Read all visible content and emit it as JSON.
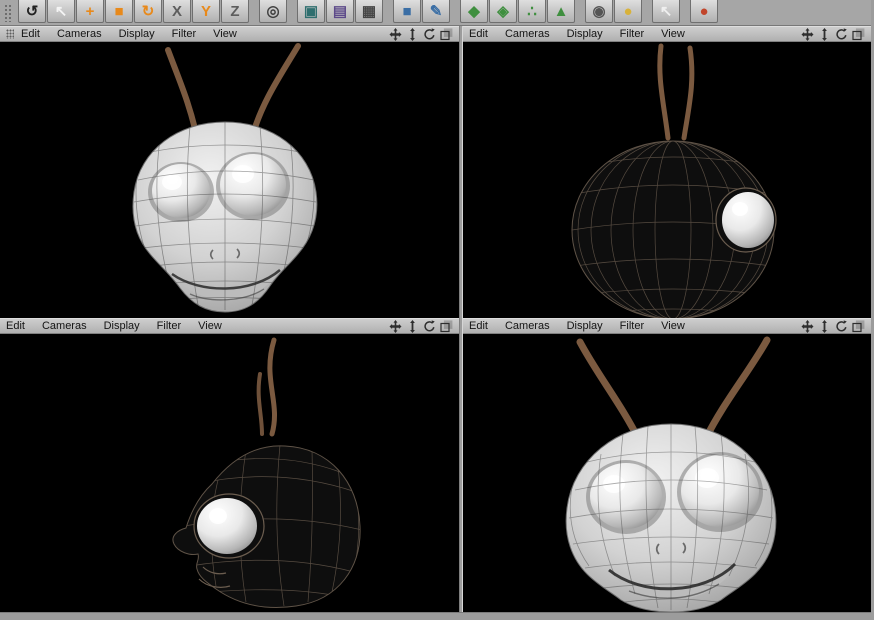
{
  "colors": {
    "toolbar_icon_accent": "#e8891a",
    "antenna_brown": "#7b5a40",
    "wireframe_brown": "#5f5347",
    "viewport_background": "#000000",
    "chrome_gray": "#a6a6a6"
  },
  "toolbar": {
    "icons": [
      {
        "name": "undo",
        "glyph": "↺",
        "color": "#222222"
      },
      {
        "name": "selection",
        "glyph": "↖",
        "color": "#f4f4f4"
      },
      {
        "name": "move",
        "glyph": "+",
        "color": "#e8891a"
      },
      {
        "name": "scale",
        "glyph": "■",
        "color": "#e8891a"
      },
      {
        "name": "rotate",
        "glyph": "↻",
        "color": "#e8891a"
      },
      {
        "name": "x-axis-lock",
        "glyph": "X",
        "color": "#5d5d5d"
      },
      {
        "name": "y-axis-lock",
        "glyph": "Y",
        "color": "#e8891a"
      },
      {
        "name": "z-axis-lock",
        "glyph": "Z",
        "color": "#5d5d5d"
      },
      {
        "name": "coordinate-system",
        "glyph": "◎",
        "color": "#3f3f3f",
        "sep_before": true
      },
      {
        "name": "render-view",
        "glyph": "▣",
        "color": "#2f6f6f",
        "sep_before": true
      },
      {
        "name": "render-picture-viewer",
        "glyph": "▤",
        "color": "#5d4a8a"
      },
      {
        "name": "render-settings",
        "glyph": "▦",
        "color": "#454545"
      },
      {
        "name": "primitive-cube",
        "glyph": "■",
        "color": "#3a6ea5",
        "sep_before": true
      },
      {
        "name": "spline-pen",
        "glyph": "✎",
        "color": "#3a6ea5"
      },
      {
        "name": "nurbs",
        "glyph": "◆",
        "color": "#3f8f3f",
        "sep_before": true
      },
      {
        "name": "array",
        "glyph": "◈",
        "color": "#3f8f3f"
      },
      {
        "name": "particles",
        "glyph": "∴",
        "color": "#3f8f3f"
      },
      {
        "name": "deformer",
        "glyph": "▲",
        "color": "#3f8f3f"
      },
      {
        "name": "camera",
        "glyph": "◉",
        "color": "#555555",
        "sep_before": true
      },
      {
        "name": "light",
        "glyph": "●",
        "color": "#d8b23a"
      },
      {
        "name": "selection-tool",
        "glyph": "↖",
        "color": "#efefef",
        "sep_before": true
      },
      {
        "name": "material",
        "glyph": "●",
        "color": "#c1452b",
        "sep_before": true
      }
    ]
  },
  "viewport_menu": {
    "items": [
      "Edit",
      "Cameras",
      "Display",
      "Filter",
      "View"
    ]
  },
  "viewport_controls": {
    "icons": [
      "pan",
      "zoom",
      "rotate",
      "toggle-maximize"
    ]
  }
}
